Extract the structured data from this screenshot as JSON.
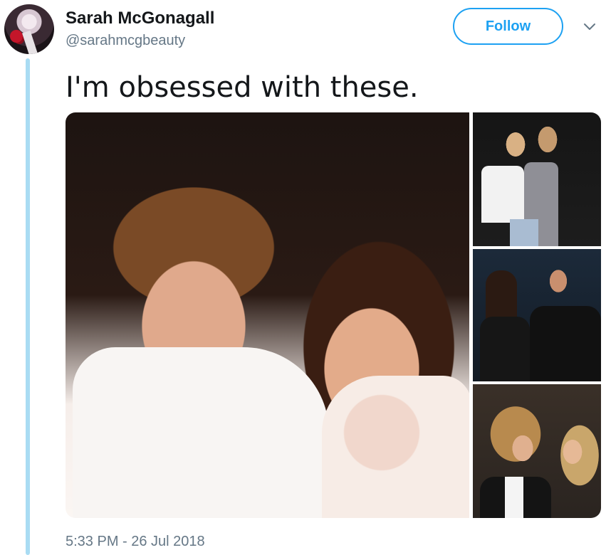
{
  "tweet": {
    "author_name": "Sarah McGonagall",
    "author_handle": "@sarahmcgbeauty",
    "follow_label": "Follow",
    "text": "I'm obsessed with these.",
    "timestamp": "5:33 PM - 26 Jul 2018"
  },
  "media": {
    "count": 4,
    "photos": [
      "prom-photo",
      "premiere-photo-1",
      "premiere-photo-2",
      "premiere-photo-3"
    ]
  },
  "icons": {
    "menu": "chevron-down-icon"
  },
  "colors": {
    "accent": "#1da1f2",
    "thread_line": "#a9dcf3",
    "secondary_text": "#657786",
    "primary_text": "#14171a"
  }
}
